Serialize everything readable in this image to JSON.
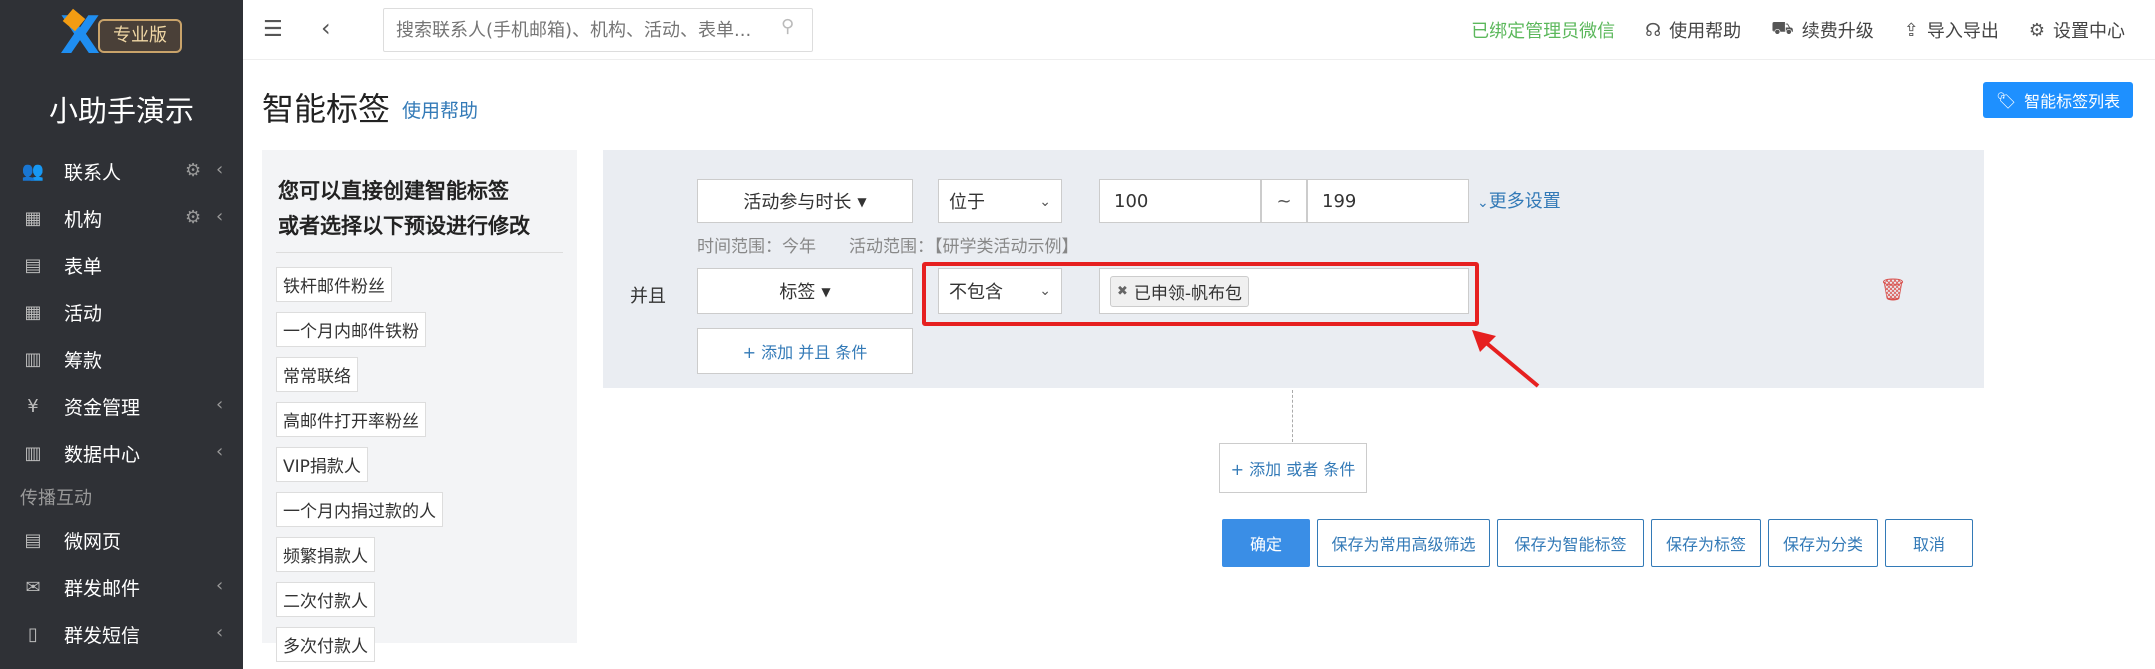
{
  "sidebar": {
    "logo_badge": "专业版",
    "app_name": "小助手演示",
    "items": [
      {
        "label": "联系人",
        "icon": "contacts-icon",
        "glyph": "👥",
        "gear": true,
        "chevron": true
      },
      {
        "label": "机构",
        "icon": "building-icon",
        "glyph": "▦",
        "gear": true,
        "chevron": true
      },
      {
        "label": "表单",
        "icon": "clipboard-icon",
        "glyph": "▤",
        "gear": false,
        "chevron": false
      },
      {
        "label": "活动",
        "icon": "calendar-icon",
        "glyph": "▦",
        "gear": false,
        "chevron": false
      },
      {
        "label": "筹款",
        "icon": "money-icon",
        "glyph": "▥",
        "gear": false,
        "chevron": false
      },
      {
        "label": "资金管理",
        "icon": "yen-icon",
        "glyph": "¥",
        "gear": false,
        "chevron": true
      },
      {
        "label": "数据中心",
        "icon": "database-icon",
        "glyph": "▥",
        "gear": false,
        "chevron": true
      }
    ],
    "group_label": "传播互动",
    "items2": [
      {
        "label": "微网页",
        "icon": "webpage-icon",
        "glyph": "▤",
        "chevron": false
      },
      {
        "label": "群发邮件",
        "icon": "email-icon",
        "glyph": "✉",
        "chevron": true
      },
      {
        "label": "群发短信",
        "icon": "phone-icon",
        "glyph": "▯",
        "chevron": true
      }
    ]
  },
  "topbar": {
    "search_placeholder": "搜索联系人(手机邮箱)、机构、活动、表单...",
    "bound_text": "已绑定管理员微信",
    "links": [
      {
        "label": "使用帮助",
        "icon": "headset-icon",
        "glyph": "☊"
      },
      {
        "label": "续费升级",
        "icon": "cart-icon",
        "glyph": "⛟"
      },
      {
        "label": "导入导出",
        "icon": "upload-icon",
        "glyph": "⇪"
      },
      {
        "label": "设置中心",
        "icon": "gear-icon",
        "glyph": "⚙"
      }
    ]
  },
  "page": {
    "title": "智能标签",
    "help_link": "使用帮助",
    "tag_list_button": "智能标签列表"
  },
  "presets": {
    "heading_line1": "您可以直接创建智能标签",
    "heading_line2": "或者选择以下预设进行修改",
    "items": [
      "铁杆邮件粉丝",
      "一个月内邮件铁粉",
      "常常联络",
      "高邮件打开率粉丝",
      "VIP捐款人",
      "一个月内捐过款的人",
      "频繁捐款人",
      "二次付款人",
      "多次付款人"
    ]
  },
  "conditions": {
    "row1": {
      "field": "活动参与时长",
      "operator": "位于",
      "min": "100",
      "tilde": "~",
      "max": "199",
      "more_settings": "更多设置",
      "time_range": "时间范围：今年",
      "activity_range": "活动范围：【研学类活动示例】"
    },
    "and_label": "并且",
    "row2": {
      "field": "标签",
      "operator": "不包含",
      "chip": "已申领-帆布包"
    },
    "add_and": "+ 添加 并且 条件"
  },
  "add_or": "+ 添加 或者 条件",
  "actions": {
    "confirm": "确定",
    "save_filter": "保存为常用高级筛选",
    "save_smart_tag": "保存为智能标签",
    "save_tag": "保存为标签",
    "save_category": "保存为分类",
    "cancel": "取消"
  },
  "colors": {
    "sidebar_bg": "#2f3136",
    "primary": "#3a8ee6",
    "link": "#337ab7",
    "bound_green": "#5cb85c",
    "highlight_red": "#e62020",
    "delete_red": "#d9534f"
  }
}
